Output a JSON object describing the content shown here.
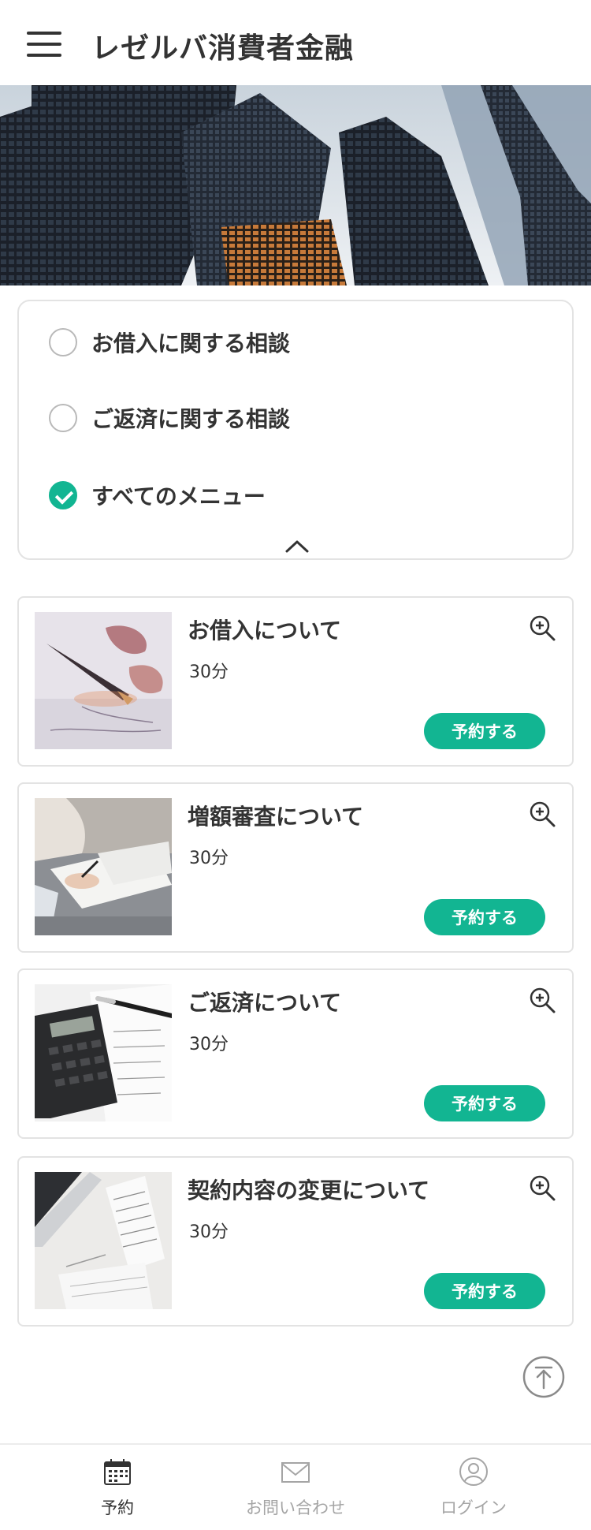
{
  "header": {
    "title": "レゼルバ消費者金融"
  },
  "filters": {
    "options": [
      {
        "label": "お借入に関する相談",
        "checked": false
      },
      {
        "label": "ご返済に関する相談",
        "checked": false
      },
      {
        "label": "すべてのメニュー",
        "checked": true
      }
    ]
  },
  "menu_items": [
    {
      "title": "お借入について",
      "duration": "30分",
      "button": "予約する",
      "image": "fountain-pen-photo"
    },
    {
      "title": "増額審査について",
      "duration": "30分",
      "button": "予約する",
      "image": "document-signing-photo"
    },
    {
      "title": "ご返済について",
      "duration": "30分",
      "button": "予約する",
      "image": "calculator-photo"
    },
    {
      "title": "契約内容の変更について",
      "duration": "30分",
      "button": "予約する",
      "image": "laptop-papers-photo"
    }
  ],
  "bottom_nav": {
    "items": [
      {
        "label": "予約",
        "icon": "calendar-icon",
        "active": true
      },
      {
        "label": "お問い合わせ",
        "icon": "mail-icon",
        "active": false
      },
      {
        "label": "ログイン",
        "icon": "user-icon",
        "active": false
      }
    ]
  },
  "colors": {
    "accent": "#12b592",
    "text": "#333333",
    "muted": "#a5a5a5",
    "border": "#e3e3e3"
  }
}
